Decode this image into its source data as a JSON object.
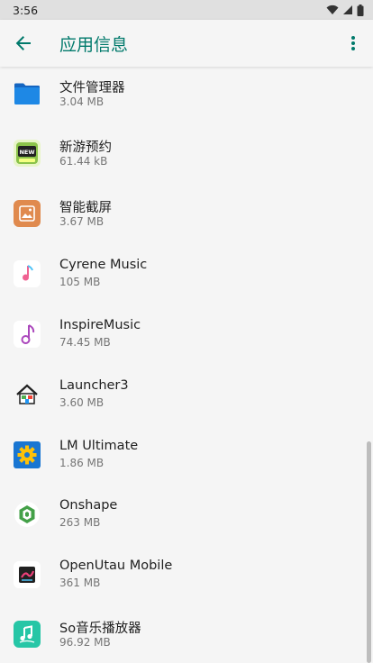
{
  "status_bar": {
    "time": "3:56"
  },
  "app_bar": {
    "title": "应用信息"
  },
  "apps": [
    {
      "name": "文件管理器",
      "size": "3.04 MB",
      "icon": "folder-icon"
    },
    {
      "name": "新游预约",
      "size": "61.44 kB",
      "icon": "new-game-icon"
    },
    {
      "name": "智能截屏",
      "size": "3.67 MB",
      "icon": "screenshot-icon"
    },
    {
      "name": "Cyrene Music",
      "size": "105 MB",
      "icon": "music-note-icon"
    },
    {
      "name": "InspireMusic",
      "size": "74.45 MB",
      "icon": "music-note-outline-icon"
    },
    {
      "name": "Launcher3",
      "size": "3.60 MB",
      "icon": "home-icon"
    },
    {
      "name": "LM Ultimate",
      "size": "1.86 MB",
      "icon": "gear-icon"
    },
    {
      "name": "Onshape",
      "size": "263 MB",
      "icon": "onshape-icon"
    },
    {
      "name": "OpenUtau Mobile",
      "size": "361 MB",
      "icon": "openutau-icon"
    },
    {
      "name": "So音乐播放器",
      "size": "96.92 MB",
      "icon": "so-music-icon"
    }
  ],
  "colors": {
    "accent": "#00796b",
    "background": "#f5f5f5"
  }
}
